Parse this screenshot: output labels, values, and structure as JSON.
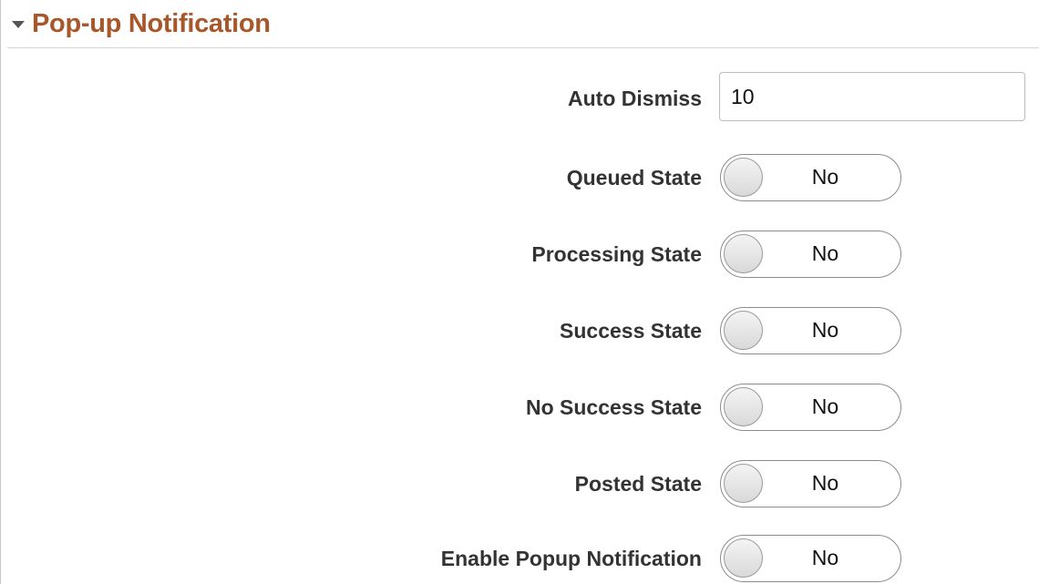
{
  "section": {
    "title": "Pop-up Notification",
    "icon": "collapse-triangle-down",
    "title_color": "#a8572a"
  },
  "fields": {
    "auto_dismiss": {
      "label": "Auto Dismiss",
      "value": "10"
    },
    "queued_state": {
      "label": "Queued State",
      "value": "No"
    },
    "processing_state": {
      "label": "Processing State",
      "value": "No"
    },
    "success_state": {
      "label": "Success State",
      "value": "No"
    },
    "no_success_state": {
      "label": "No Success State",
      "value": "No"
    },
    "posted_state": {
      "label": "Posted State",
      "value": "No"
    },
    "enable_popup_notification": {
      "label": "Enable Popup Notification",
      "value": "No"
    }
  }
}
